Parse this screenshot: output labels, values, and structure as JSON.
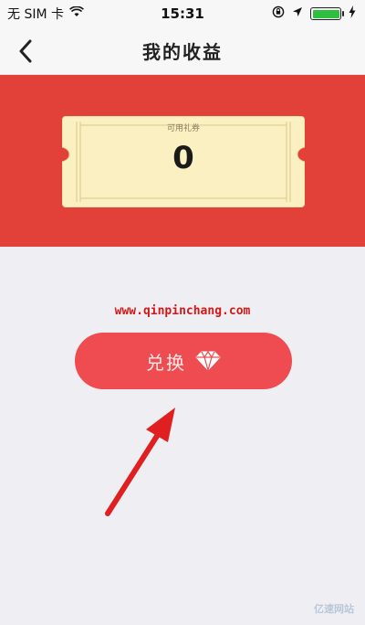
{
  "status_bar": {
    "carrier": "无 SIM 卡",
    "time": "15:31"
  },
  "nav": {
    "title": "我的收益"
  },
  "ticket": {
    "label": "可用礼券",
    "value": "0"
  },
  "watermark": {
    "url": "www.qinpinchang.com",
    "corner_logo": "亿速网站"
  },
  "exchange_button": {
    "label": "兑换"
  },
  "colors": {
    "banner": "#e2413a",
    "button": "#ee4c51",
    "ticket": "#faf0c2",
    "arrow": "#e02020"
  },
  "icons": {
    "wifi": "wifi-icon",
    "lock": "orientation-lock-icon",
    "location": "location-arrow-icon",
    "battery": "battery-icon",
    "charging": "charging-bolt-icon",
    "back": "chevron-left-icon",
    "diamond": "diamond-icon",
    "arrow": "red-pointer-arrow"
  }
}
